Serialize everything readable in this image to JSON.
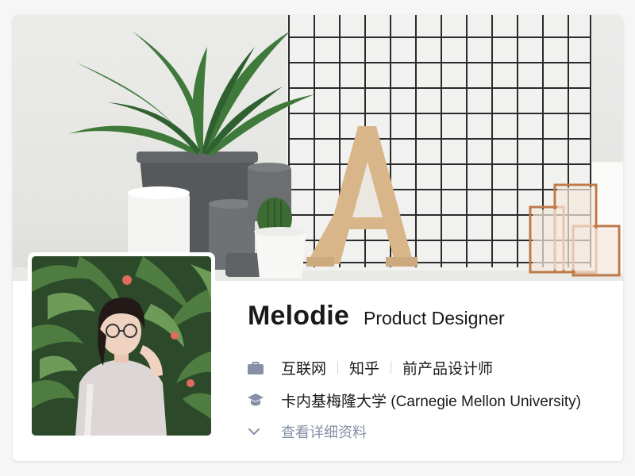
{
  "profile": {
    "name": "Melodie",
    "headline": "Product Designer",
    "employment": {
      "icon": "briefcase-icon",
      "items": [
        "互联网",
        "知乎",
        "前产品设计师"
      ]
    },
    "education": {
      "icon": "graduation-cap-icon",
      "school": "卡内基梅隆大学 (Carnegie Mellon University)"
    },
    "more": {
      "icon": "chevron-down-icon",
      "label": "查看详细资料"
    }
  },
  "colors": {
    "primary_text": "#1a1a1a",
    "secondary_text": "#8590a6",
    "icon": "#8590a6",
    "card_bg": "#ffffff",
    "page_bg": "#f6f6f6"
  }
}
